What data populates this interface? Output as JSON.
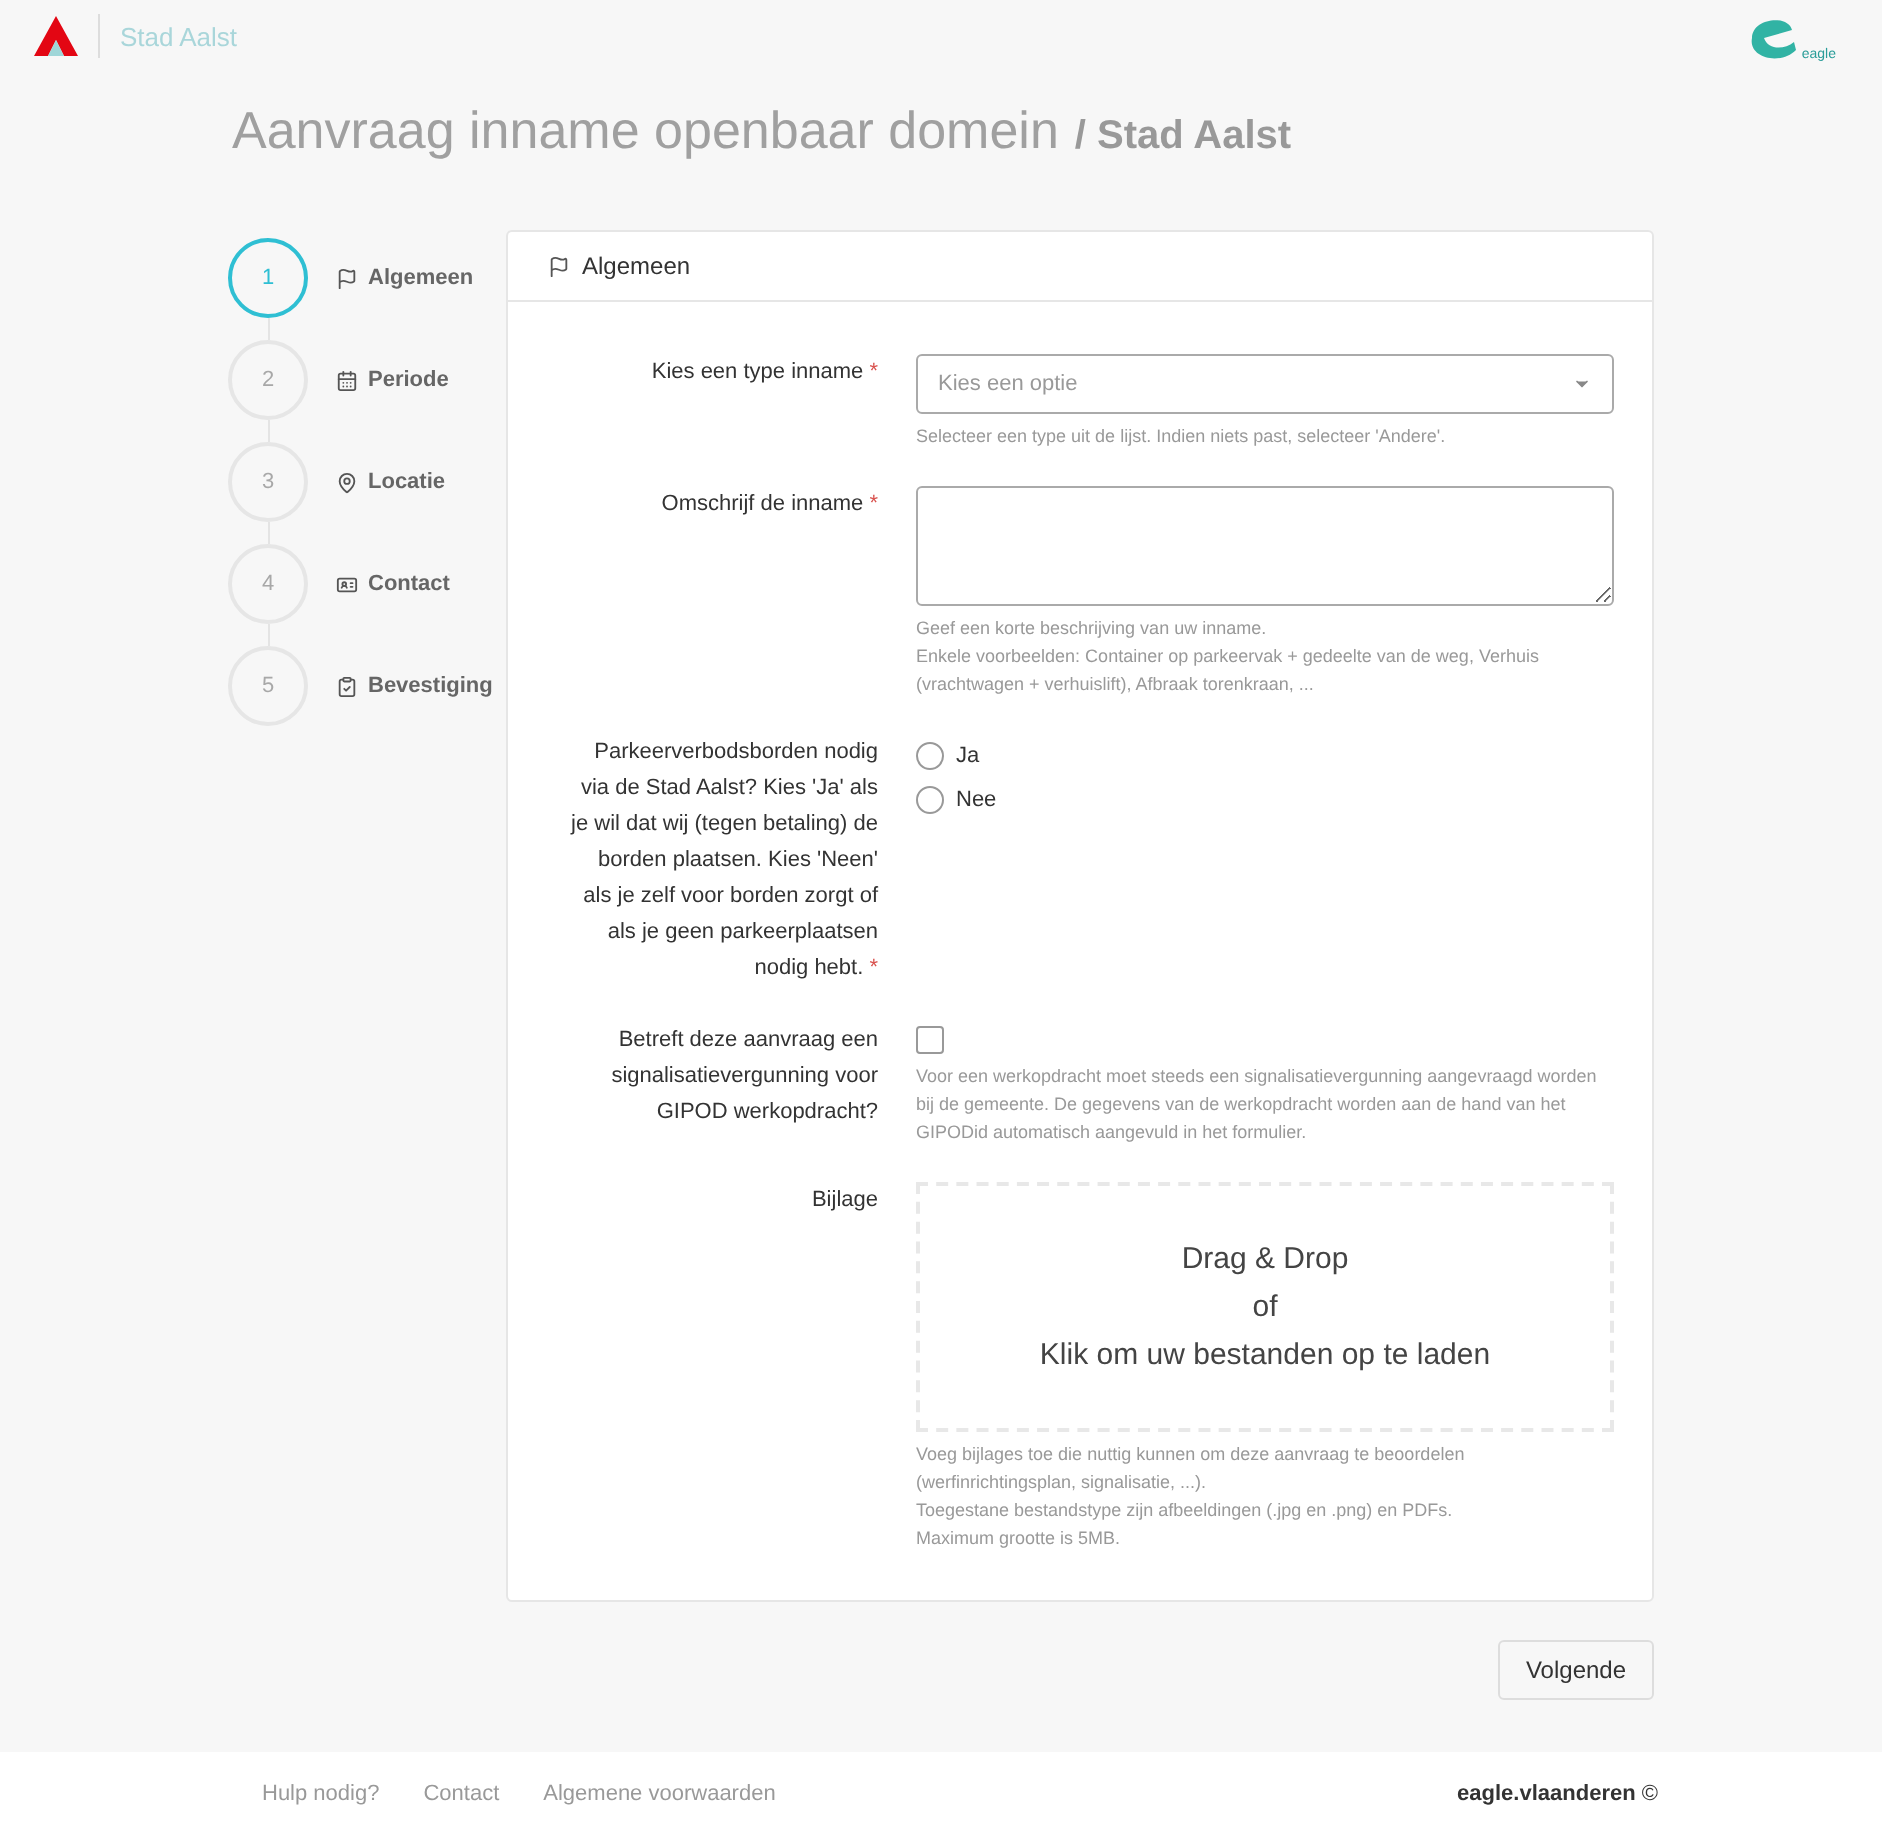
{
  "header": {
    "brand": "Stad Aalst",
    "logo_text": "eagle"
  },
  "page_title": {
    "title": "Aanvraag inname openbaar domein",
    "subtitle": "/ Stad Aalst"
  },
  "steps": [
    {
      "number": "1",
      "label": "Algemeen",
      "kind": "flag",
      "selected": true
    },
    {
      "number": "2",
      "label": "Periode",
      "kind": "calendar",
      "selected": false
    },
    {
      "number": "3",
      "label": "Locatie",
      "kind": "pin",
      "selected": false
    },
    {
      "number": "4",
      "label": "Contact",
      "kind": "card",
      "selected": false
    },
    {
      "number": "5",
      "label": "Bevestiging",
      "kind": "clipboard",
      "selected": false
    }
  ],
  "card": {
    "title": "Algemeen",
    "kind": "flag"
  },
  "fields": [
    {
      "kind": "select",
      "label": "Kies een type inname",
      "required_mark": "*",
      "placeholder": "Kies een optie",
      "help": [
        "Selecteer een type uit de lijst. Indien niets past, selecteer 'Andere'."
      ]
    },
    {
      "kind": "textarea",
      "label": "Omschrijf de inname",
      "required_mark": "*",
      "help": [
        "Geef een korte beschrijving van uw inname.",
        "Enkele voorbeelden: Container op parkeervak + gedeelte van de weg, Verhuis (vrachtwagen + verhuislift), Afbraak torenkraan, ..."
      ]
    },
    {
      "kind": "radio",
      "label": "Parkeerverbodsborden nodig via de Stad Aalst? Kies 'Ja' als je wil dat wij (tegen betaling) de borden plaatsen. Kies 'Neen' als je zelf voor borden zorgt of als je geen parkeerplaatsen nodig hebt.",
      "required_mark": "*",
      "options": [
        {
          "label": "Ja",
          "selected": false
        },
        {
          "label": "Nee",
          "selected": false
        }
      ]
    },
    {
      "kind": "checkbox",
      "label": "Betreft deze aanvraag een signalisatievergunning voor GIPOD werkopdracht?",
      "checked": false,
      "help": [
        "Voor een werkopdracht moet steeds een signalisatievergunning aangevraagd worden bij de gemeente. De gegevens van de werkopdracht worden aan de hand van het GIPODid automatisch aangevuld in het formulier."
      ]
    },
    {
      "kind": "dropzone",
      "label": "Bijlage",
      "lines": [
        "Drag & Drop",
        "of",
        "Klik om uw bestanden op te laden"
      ],
      "help": [
        "Voeg bijlages toe die nuttig kunnen om deze aanvraag te beoordelen (werfinrichtingsplan, signalisatie, ...).",
        "Toegestane bestandstype zijn afbeeldingen (.jpg en .png) en PDFs.",
        "Maximum grootte is 5MB."
      ]
    }
  ],
  "next_button": "Volgende",
  "footer": {
    "links": [
      "Hulp nodig?",
      "Contact",
      "Algemene voorwaarden"
    ],
    "copyright": "**eagle.vlaanderen** ©"
  }
}
